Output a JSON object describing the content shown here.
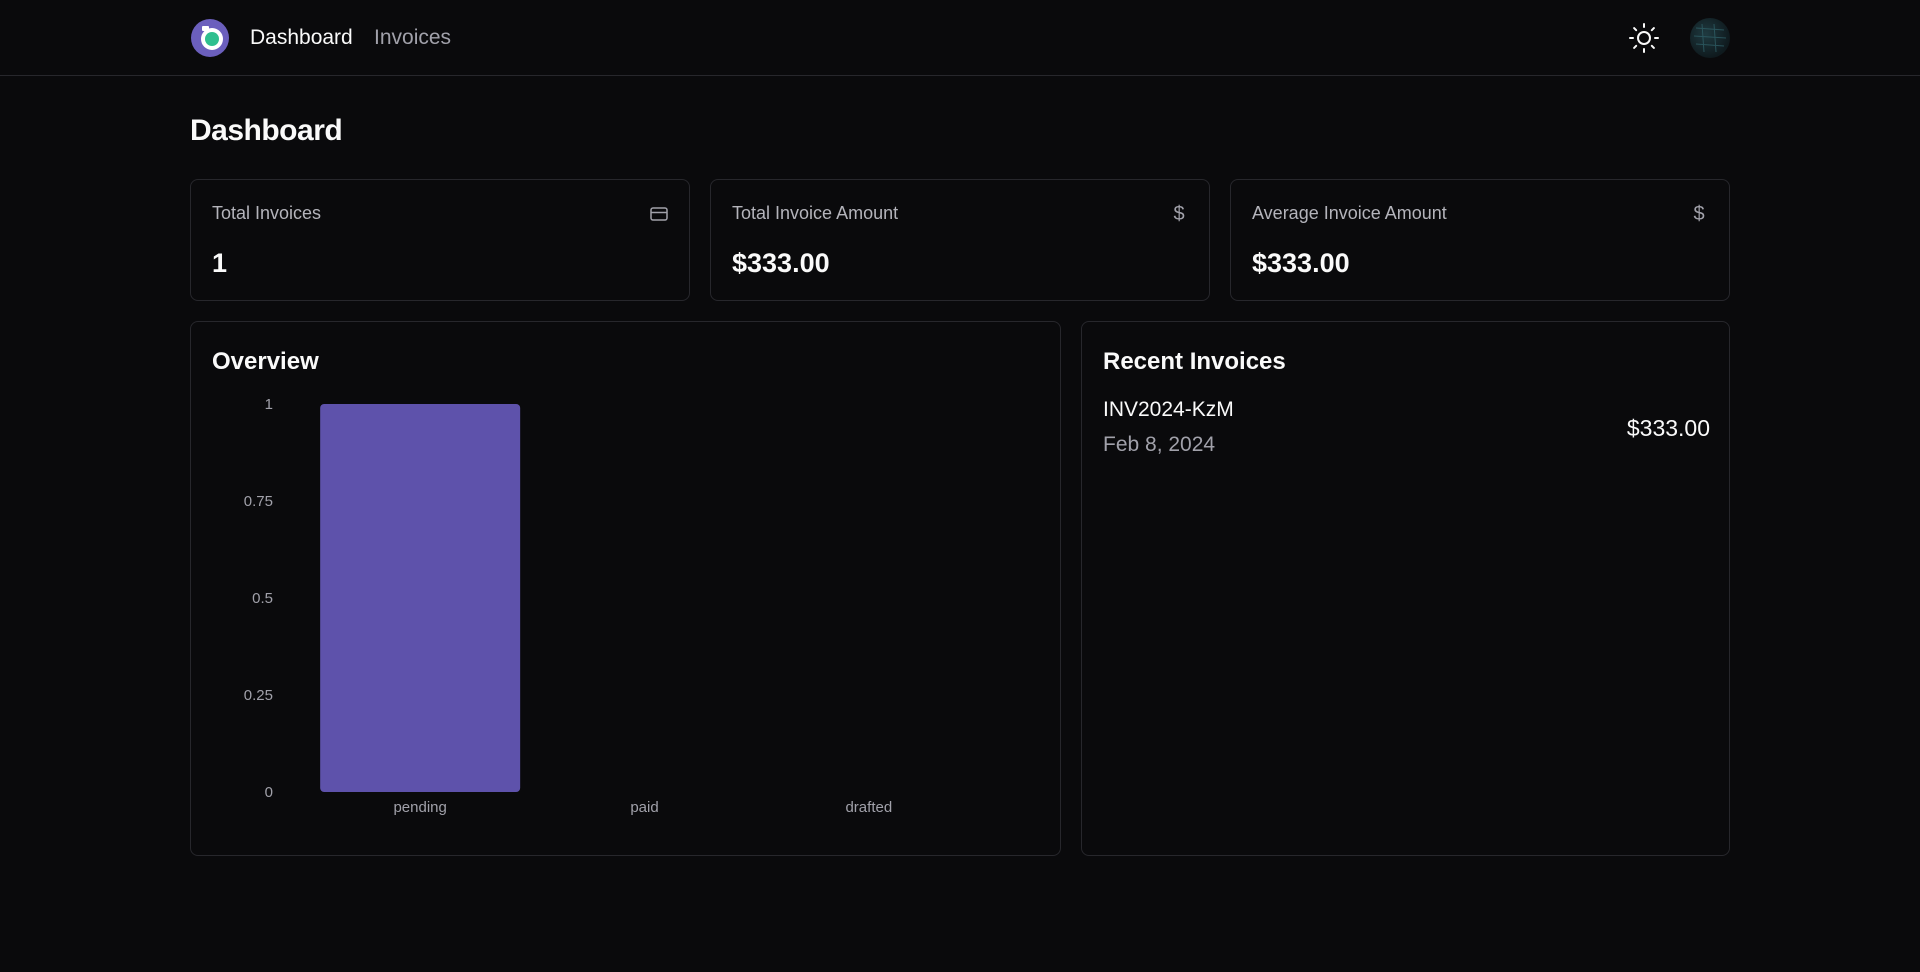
{
  "nav": {
    "logo_icon": "app-logo-icon",
    "links": [
      {
        "label": "Dashboard",
        "active": true
      },
      {
        "label": "Invoices",
        "active": false
      }
    ],
    "theme_toggle_icon": "sun-icon",
    "avatar_icon": "user-avatar"
  },
  "page": {
    "title": "Dashboard"
  },
  "stats": [
    {
      "label": "Total Invoices",
      "value": "1",
      "icon": "credit-card-icon"
    },
    {
      "label": "Total Invoice Amount",
      "value": "$333.00",
      "icon": "dollar-icon"
    },
    {
      "label": "Average Invoice Amount",
      "value": "$333.00",
      "icon": "dollar-icon"
    }
  ],
  "overview": {
    "title": "Overview"
  },
  "recent": {
    "title": "Recent Invoices",
    "invoices": [
      {
        "id": "INV2024-KzM",
        "date": "Feb 8, 2024",
        "amount": "$333.00"
      }
    ]
  },
  "colors": {
    "bar": "#5e52ab",
    "background": "#0a0a0c",
    "border": "#27272c"
  },
  "chart_data": {
    "type": "bar",
    "categories": [
      "pending",
      "paid",
      "drafted"
    ],
    "values": [
      1,
      0,
      0
    ],
    "yticks": [
      "0",
      "0.25",
      "0.5",
      "0.75",
      "1"
    ],
    "ylim": [
      0,
      1
    ],
    "grid": false,
    "legend": "none"
  }
}
